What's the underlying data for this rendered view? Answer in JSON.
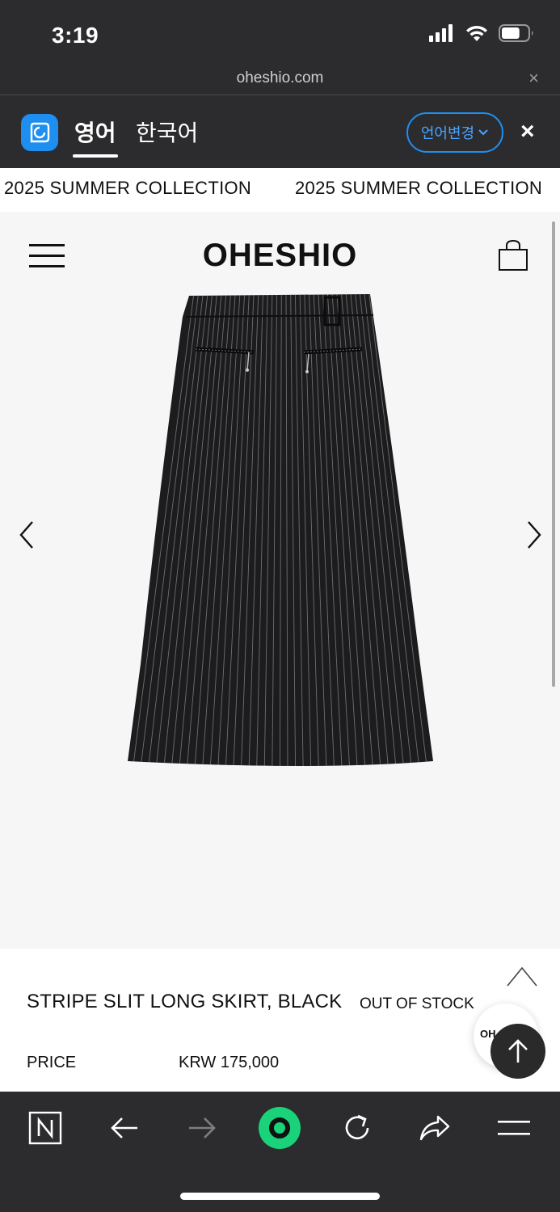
{
  "status_bar": {
    "time": "3:19",
    "battery_level": 0.7
  },
  "url_bar": {
    "domain": "oheshio.com",
    "close_glyph": "×"
  },
  "translate_bar": {
    "tabs": [
      {
        "label": "영어",
        "active": true
      },
      {
        "label": "한국어",
        "active": false
      }
    ],
    "change_language_label": "언어변경",
    "close_glyph": "×",
    "accent_color": "#1e8ff0"
  },
  "marquee": {
    "items": [
      "2025 SUMMER COLLECTION",
      "2025 SUMMER COLLECTION"
    ]
  },
  "site": {
    "brand": "OHESHIO",
    "product": {
      "name": "STRIPE SLIT LONG SKIRT, BLACK",
      "stock_status": "OUT OF STOCK",
      "price_label": "PRICE",
      "price_value": "KRW 175,000"
    },
    "badge_text": "OH"
  },
  "toolbar": {
    "items": [
      "naver-home-icon",
      "back-arrow-icon",
      "forward-arrow-icon",
      "green-circle-icon",
      "reload-icon",
      "share-icon",
      "menu-icon"
    ],
    "green_button_color": "#19d27a"
  }
}
